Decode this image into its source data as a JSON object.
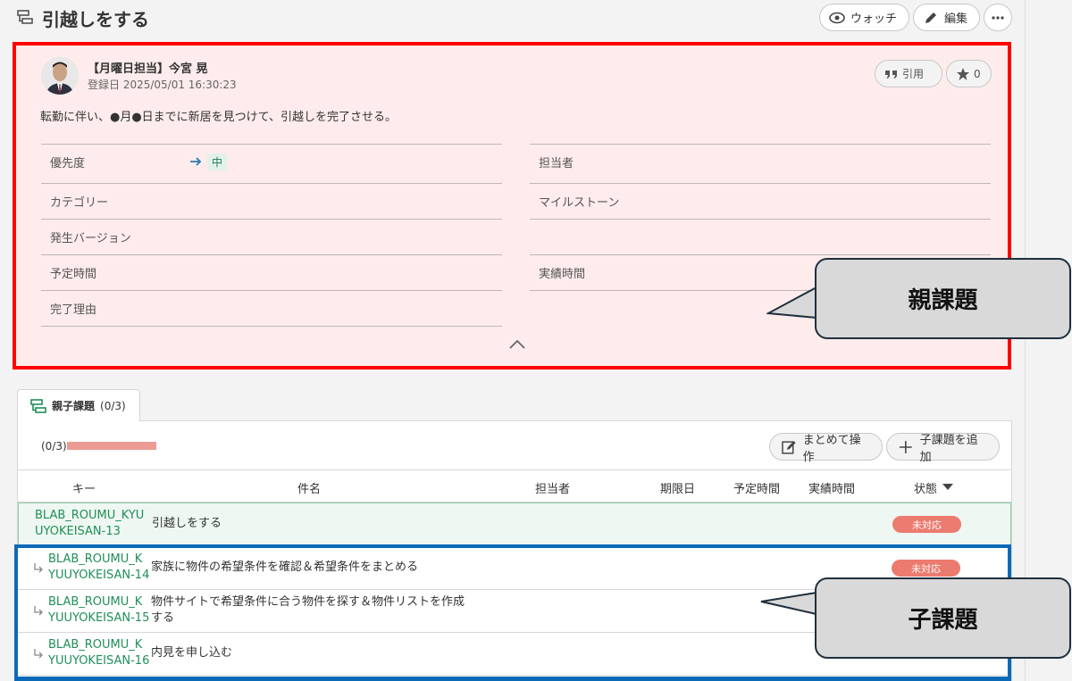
{
  "header": {
    "title": "引越しをする",
    "watch_label": "ウォッチ",
    "edit_label": "編集"
  },
  "issue": {
    "author": "【月曜日担当】今宮 晃",
    "registered": "登録日 2025/05/01 16:30:23",
    "quote_label": "引用",
    "star_count": "0",
    "description": "転勤に伴い、●月●日までに新居を見つけて、引越しを完了させる。",
    "fields_left": [
      {
        "label": "優先度",
        "value": "中"
      },
      {
        "label": "カテゴリー",
        "value": ""
      },
      {
        "label": "発生バージョン",
        "value": ""
      },
      {
        "label": "予定時間",
        "value": ""
      },
      {
        "label": "完了理由",
        "value": ""
      }
    ],
    "fields_right": [
      {
        "label": "担当者",
        "value": ""
      },
      {
        "label": "マイルストーン",
        "value": ""
      },
      {
        "label": "",
        "value": ""
      },
      {
        "label": "実績時間",
        "value": ""
      }
    ]
  },
  "callouts": {
    "parent": "親課題",
    "child": "子課題"
  },
  "subtasks": {
    "tab_label": "親子課題",
    "tab_count": "(0/3)",
    "progress_text": "(0/3)",
    "progress": 1.0,
    "bulk_label": "まとめて操作",
    "add_label": "子課題を追加",
    "columns": [
      "キー",
      "件名",
      "担当者",
      "期限日",
      "予定時間",
      "実績時間",
      "状態"
    ],
    "parent_row": {
      "key_line1": "BLAB_ROUMU_KYU",
      "key_line2": "UYOKEISAN-13",
      "title": "引越しをする",
      "status": "未対応"
    },
    "children": [
      {
        "key_line1": "BLAB_ROUMU_K",
        "key_line2": "YUUYOKEISAN-14",
        "title_line1": "家族に物件の希望条件を確認＆希望条件をまとめる",
        "title_line2": "",
        "status": "未対応"
      },
      {
        "key_line1": "BLAB_ROUMU_K",
        "key_line2": "YUUYOKEISAN-15",
        "title_line1": "物件サイトで希望条件に合う物件を探す＆物件リストを作成",
        "title_line2": "する",
        "status": ""
      },
      {
        "key_line1": "BLAB_ROUMU_K",
        "key_line2": "YUUYOKEISAN-16",
        "title_line1": "内見を申し込む",
        "title_line2": "",
        "status": ""
      }
    ]
  },
  "colors": {
    "parent_border": "#ff0000",
    "child_border": "#0b6ab8",
    "status_bg": "#ec7b6f",
    "key_color": "#1f8f57"
  }
}
